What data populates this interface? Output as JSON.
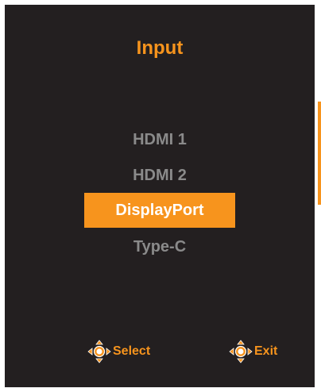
{
  "menu": {
    "title": "Input",
    "items": [
      {
        "label": "HDMI 1",
        "selected": false
      },
      {
        "label": "HDMI 2",
        "selected": false
      },
      {
        "label": "DisplayPort",
        "selected": true
      },
      {
        "label": "Type-C",
        "selected": false
      }
    ]
  },
  "hints": {
    "select": {
      "label": "Select",
      "icon": "joystick-icon"
    },
    "exit": {
      "label": "Exit",
      "icon": "joystick-icon"
    }
  },
  "colors": {
    "accent": "#f7941d",
    "background": "#231f20",
    "item_text": "#8a8a8a",
    "selected_text": "#ffffff"
  }
}
